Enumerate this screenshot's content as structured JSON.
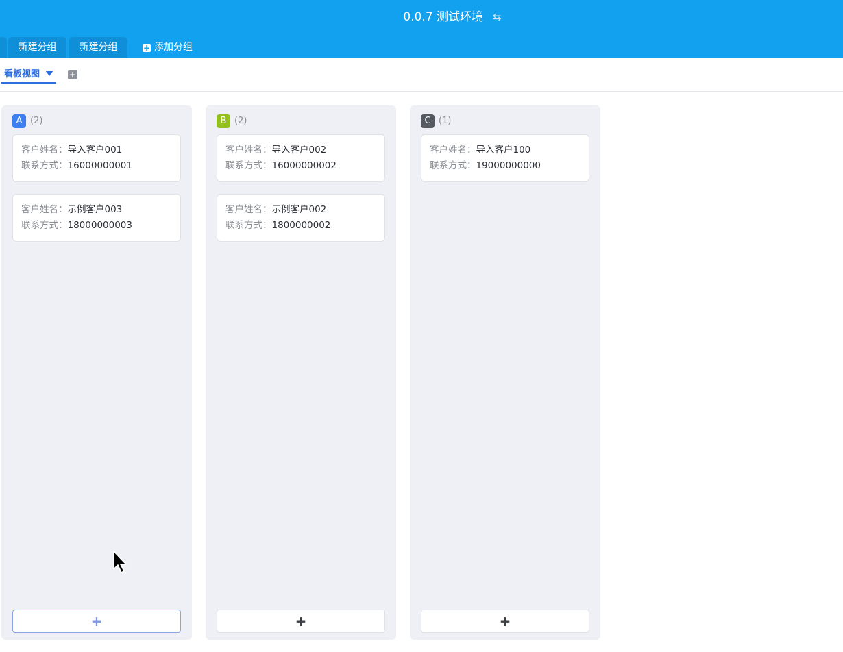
{
  "header": {
    "title": "0.0.7 测试环境",
    "swap_icon": "⇆"
  },
  "tabs": {
    "items": [
      {
        "label": "新建分组"
      },
      {
        "label": "新建分组"
      }
    ],
    "add_label": "添加分组"
  },
  "view": {
    "active_label": "看板视图"
  },
  "columns": [
    {
      "key": "A",
      "count": "(2)",
      "color": "#3b7ff0",
      "cards": [
        {
          "name_label": "客户姓名：",
          "name": "导入客户001",
          "contact_label": "联系方式：",
          "contact": "16000000001"
        },
        {
          "name_label": "客户姓名：",
          "name": "示例客户003",
          "contact_label": "联系方式：",
          "contact": "18000000003"
        }
      ]
    },
    {
      "key": "B",
      "count": "(2)",
      "color": "#93c01f",
      "cards": [
        {
          "name_label": "客户姓名：",
          "name": "导入客户002",
          "contact_label": "联系方式：",
          "contact": "16000000002"
        },
        {
          "name_label": "客户姓名：",
          "name": "示例客户002",
          "contact_label": "联系方式：",
          "contact": "1800000002"
        }
      ]
    },
    {
      "key": "C",
      "count": "(1)",
      "color": "#555a61",
      "cards": [
        {
          "name_label": "客户姓名：",
          "name": "导入客户100",
          "contact_label": "联系方式：",
          "contact": "19000000000"
        }
      ]
    }
  ],
  "add_card_symbol": "+"
}
